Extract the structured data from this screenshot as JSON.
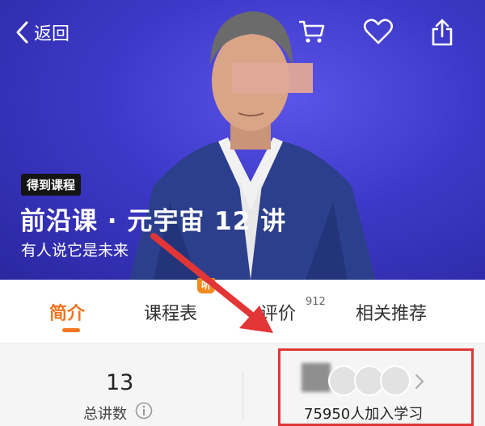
{
  "header": {
    "back_label": "返回",
    "badge": "得到课程",
    "title": "前沿课 · 元宇宙 12 讲",
    "subtitle": "有人说它是未来"
  },
  "tabs": {
    "items": [
      {
        "label": "简介"
      },
      {
        "label": "课程表",
        "tag": "听"
      },
      {
        "label": "评价",
        "count": "912"
      },
      {
        "label": "相关推荐"
      }
    ],
    "active_index": 0
  },
  "stats": {
    "lecture_count": "13",
    "lecture_label": "总讲数",
    "learners": "75950人加入学习"
  },
  "icons": [
    "chevron-left-icon",
    "cart-icon",
    "heart-icon",
    "share-icon",
    "info-icon",
    "chevron-right-icon"
  ],
  "colors": {
    "accent": "#f07520",
    "hero_bg": "#3d39c8",
    "annotation": "#e23636"
  }
}
